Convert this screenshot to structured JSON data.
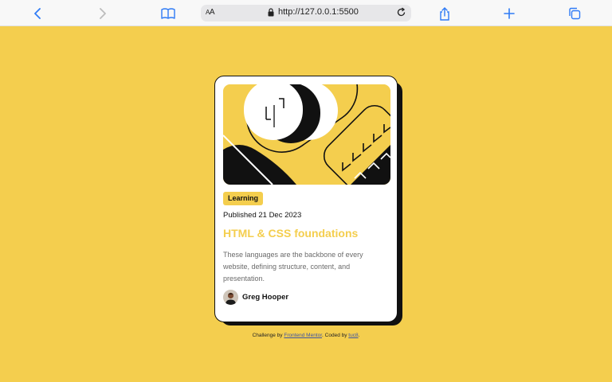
{
  "browser": {
    "text_size_label": "AA",
    "url": "http://127.0.0.1:5500",
    "icons": [
      "chevron-left-icon",
      "chevron-right-icon",
      "book-icon",
      "lock-icon",
      "reload-icon",
      "share-icon",
      "plus-icon",
      "tabs-icon"
    ]
  },
  "card": {
    "badge": "Learning",
    "published": "Published 21 Dec 2023",
    "title": "HTML & CSS foundations",
    "description": "These languages are the backbone of every website, defining structure, content, and presentation.",
    "author": "Greg Hooper"
  },
  "attribution": {
    "prefix": "Challenge by ",
    "link1": "Frontend Mentor",
    "middle": ". Coded by ",
    "link2": "tuc8",
    "suffix": "."
  },
  "colors": {
    "background": "#F4CE4E",
    "card": "#FFFFFF",
    "text": "#111111",
    "title": "#F4CE4E",
    "link": "#3E54A3",
    "toolbar_icon": "#2F7BF6"
  }
}
